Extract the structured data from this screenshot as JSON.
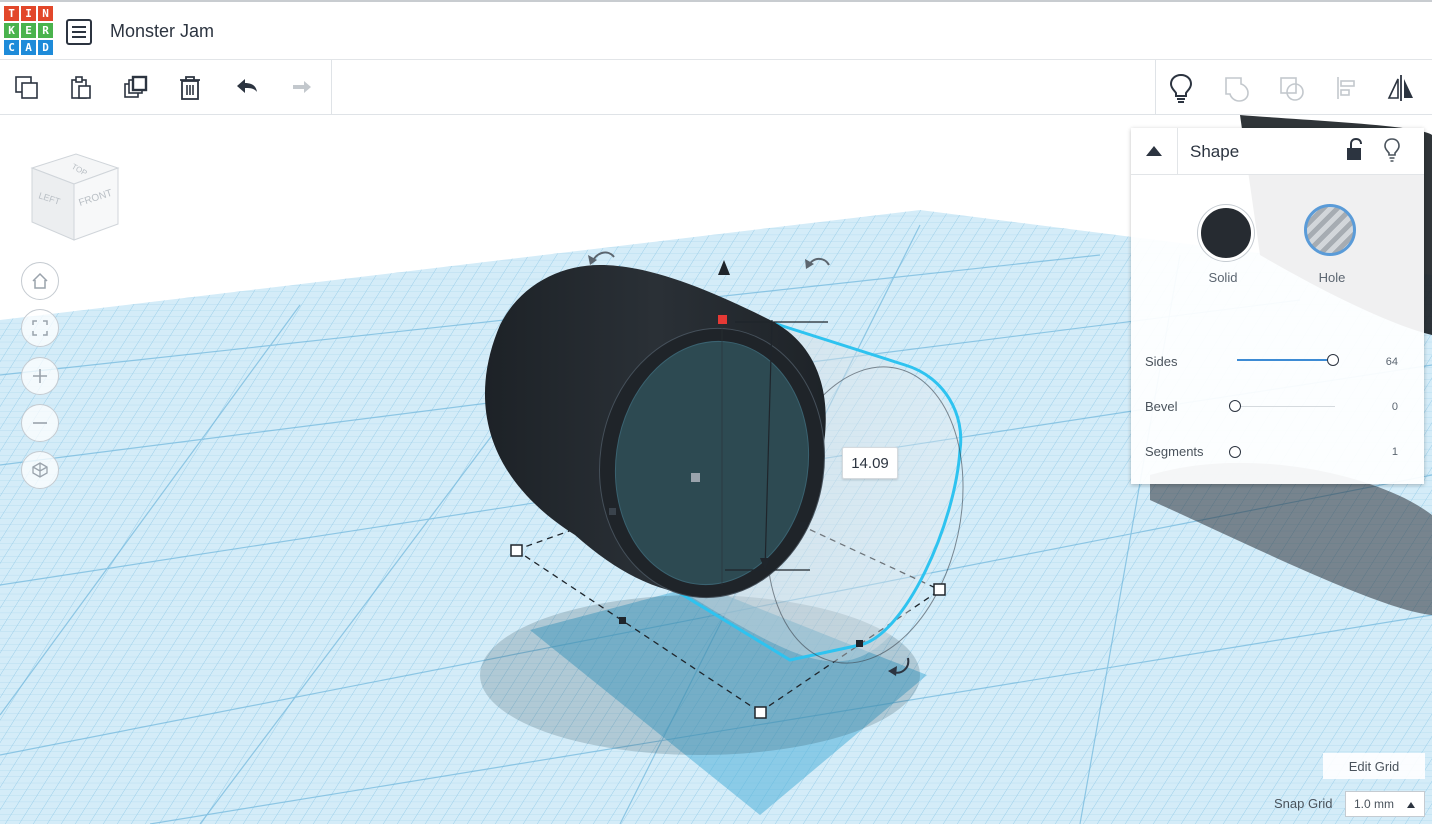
{
  "app": {
    "logo_letters": [
      "T",
      "I",
      "N",
      "K",
      "E",
      "R",
      "C",
      "A",
      "D"
    ],
    "logo_colors": [
      "#e2472a",
      "#e2472a",
      "#e2472a",
      "#4ab34d",
      "#4ab34d",
      "#4ab34d",
      "#1e8bd9",
      "#1e8bd9",
      "#1e8bd9"
    ],
    "design_title": "Monster Jam"
  },
  "toolbar": {
    "left_icons": [
      "copy-icon",
      "paste-icon",
      "duplicate-icon",
      "delete-icon",
      "undo-icon",
      "redo-icon"
    ],
    "right_icons": [
      "lightbulb-icon",
      "group-icon",
      "ungroup-icon",
      "align-icon",
      "mirror-icon"
    ]
  },
  "view_cube": {
    "faces": [
      "TOP",
      "LEFT",
      "FRONT"
    ]
  },
  "view_controls": [
    "home-icon",
    "fit-view-icon",
    "zoom-in-icon",
    "zoom-out-icon",
    "perspective-icon"
  ],
  "workplane": {
    "grid_color": "#a9d6ec",
    "selection_color": "#2ec3f0",
    "dimension_value": "14.09"
  },
  "inspector": {
    "title": "Shape",
    "solid_label": "Solid",
    "hole_label": "Hole",
    "solid_color": "#262b31",
    "properties": [
      {
        "label": "Sides",
        "value": "64",
        "level": 1.0
      },
      {
        "label": "Bevel",
        "value": "0",
        "level": 0.0
      },
      {
        "label": "Segments",
        "value": "1",
        "level": 0.0
      }
    ]
  },
  "grid_controls": {
    "edit_grid": "Edit Grid",
    "snap_label": "Snap Grid",
    "snap_value": "1.0 mm"
  }
}
